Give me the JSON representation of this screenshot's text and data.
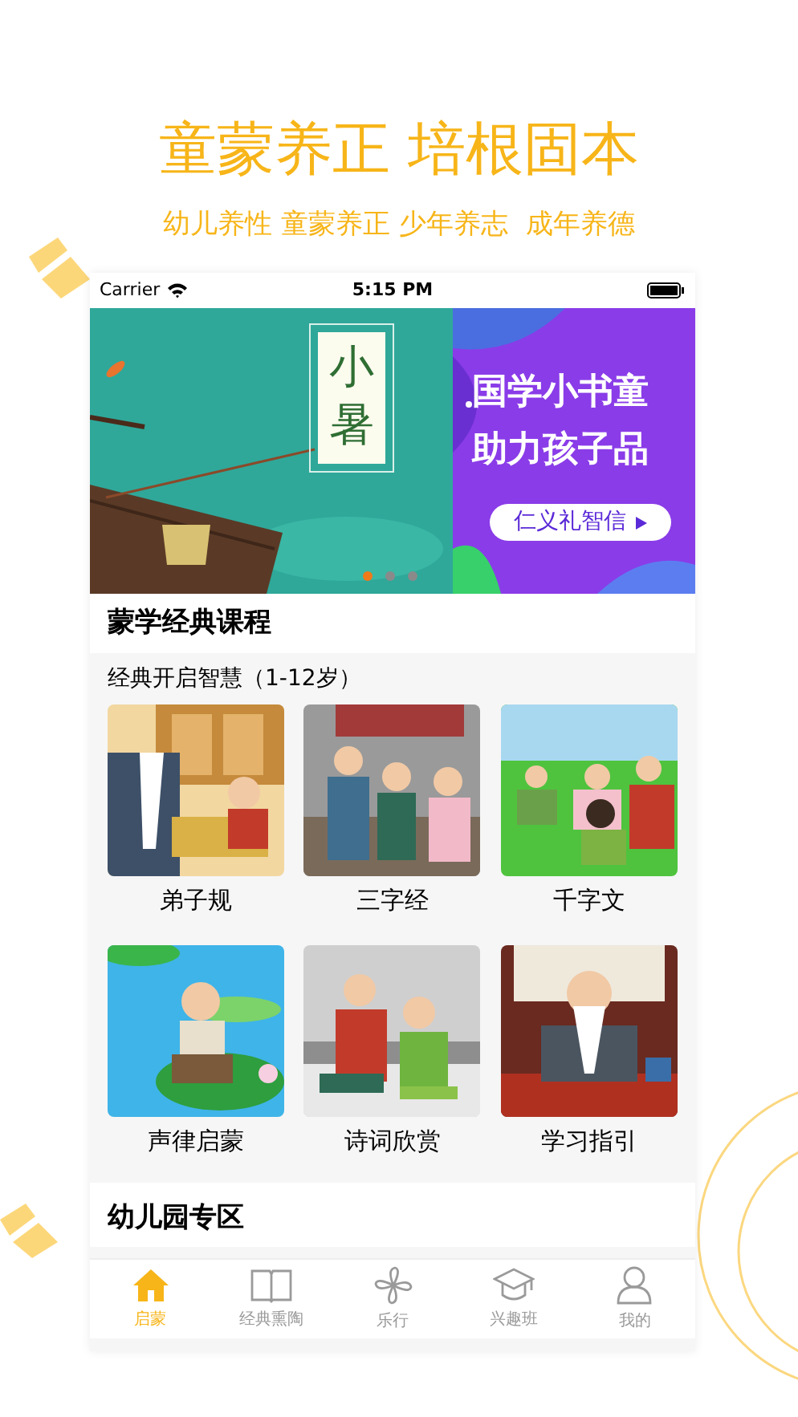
{
  "headline": "童蒙养正 培根固本",
  "subheadline": "幼儿养性 童蒙养正 少年养志  成年养德",
  "status_bar": {
    "carrier": "Carrier",
    "time": "5:15 PM"
  },
  "banner": {
    "left": {
      "title": "小暑"
    },
    "right": {
      "line_1": "国学小书童",
      "line_2": "助力孩子品",
      "button": "仁义礼智信"
    },
    "dots": [
      {
        "selected": true
      },
      {
        "selected": false
      },
      {
        "selected": false
      }
    ]
  },
  "section_1": {
    "title": "蒙学经典课程",
    "subtitle": "经典开启智慧（1-12岁）",
    "items": [
      {
        "label": "弟子规",
        "kind": "picture"
      },
      {
        "label": "三字经",
        "kind": "picture"
      },
      {
        "label": "千字文",
        "kind": "picture"
      },
      {
        "label": "声律启蒙",
        "kind": "picture"
      },
      {
        "label": "诗词欣赏",
        "kind": "picture"
      },
      {
        "label": "学习指引",
        "kind": "picture"
      }
    ]
  },
  "section_2": {
    "title": "幼儿园专区"
  },
  "tabs": [
    {
      "label": "启蒙",
      "selected": true
    },
    {
      "label": "经典熏陶",
      "selected": false
    },
    {
      "label": "乐行",
      "selected": false
    },
    {
      "label": "兴趣班",
      "selected": false
    },
    {
      "label": "我的",
      "selected": false
    }
  ]
}
